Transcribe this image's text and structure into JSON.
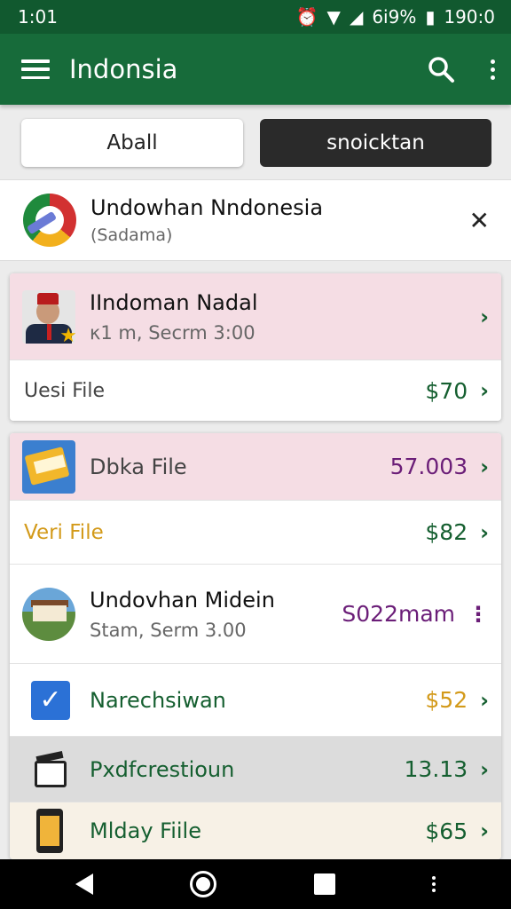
{
  "status_bar": {
    "time": "1:01",
    "battery_text": "6i9%",
    "right_time": "190:0"
  },
  "app_bar": {
    "title": "Indonsia"
  },
  "segments": {
    "all": "Aball",
    "other": "snoicktan"
  },
  "filter": {
    "title": "Undowhan Nndonesia",
    "subtitle": "(Sadama)"
  },
  "card1": {
    "title": "IIndoman Nadal",
    "subtitle": "κ1 m, Secrm 3:00",
    "footer_label": "Uesi File",
    "footer_amount": "$70"
  },
  "card2": {
    "rows": [
      {
        "label": "Dbka File",
        "amount": "57.003"
      },
      {
        "label": "Veri File",
        "amount": "$82"
      },
      {
        "title": "Undovhan Midein",
        "subtitle": "Stam, Serm 3.00",
        "amount": "S022mam"
      },
      {
        "label": "Narechsiwan",
        "amount": "$52"
      },
      {
        "label": "Pxdfcrestioun",
        "amount": "13.13"
      },
      {
        "label": "Mlday Fiile",
        "amount": "$65"
      }
    ]
  },
  "colors": {
    "app_bar": "#176b3a",
    "accent_green": "#155f30",
    "purple": "#6b1e78",
    "gold": "#d39a1a"
  }
}
